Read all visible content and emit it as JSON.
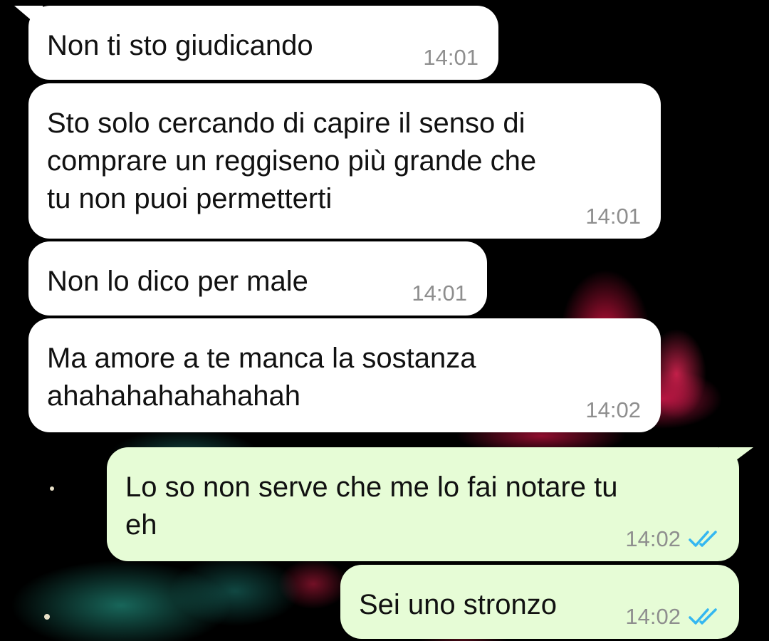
{
  "colors": {
    "incoming_bubble": "#ffffff",
    "outgoing_bubble": "#e6fcd6",
    "timestamp": "#8e8e8e",
    "read_ticks": "#34b7f1",
    "background": "#000000"
  },
  "messages": [
    {
      "direction": "incoming",
      "text": "Non ti sto giudicando",
      "time": "14:01"
    },
    {
      "direction": "incoming",
      "text": "Sto solo cercando di capire il senso di\ncomprare un reggiseno più grande che\ntu non puoi permetterti",
      "time": "14:01"
    },
    {
      "direction": "incoming",
      "text": "Non lo dico per male",
      "time": "14:01"
    },
    {
      "direction": "incoming",
      "text": "Ma amore a te manca la sostanza\nahahahahahahahah",
      "time": "14:02"
    },
    {
      "direction": "outgoing",
      "text": "Lo so non serve che me lo fai notare tu\neh",
      "time": "14:02",
      "status_icon": "double-check-read-icon"
    },
    {
      "direction": "outgoing",
      "text": "Sei uno stronzo",
      "time": "14:02",
      "status_icon": "double-check-read-icon"
    }
  ]
}
